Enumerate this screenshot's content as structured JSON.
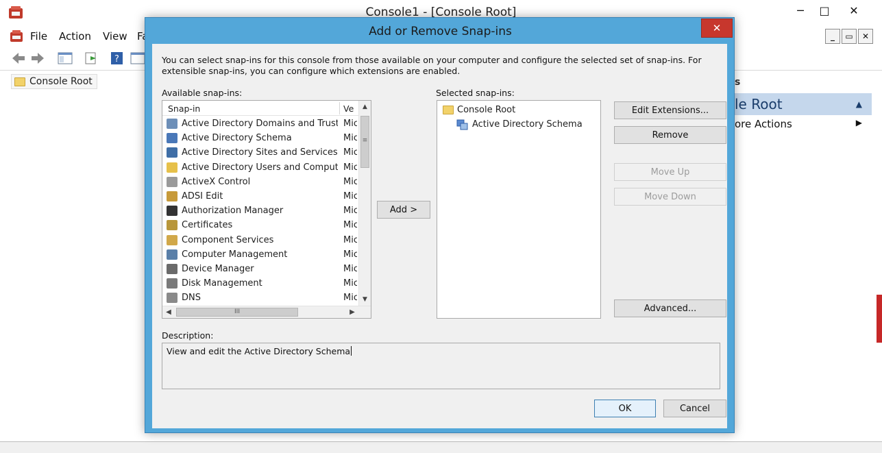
{
  "window": {
    "title": "Console1 - [Console Root]",
    "minimize": "─",
    "maximize": "□",
    "close": "✕"
  },
  "menu": {
    "items": [
      "File",
      "Action",
      "View",
      "Fa"
    ]
  },
  "inner_controls": {
    "minimize": "_",
    "restore": "▭",
    "close": "✕"
  },
  "tree": {
    "root": "Console Root"
  },
  "actions_pane": {
    "header": "s",
    "section": "le Root",
    "more_actions": "ore Actions"
  },
  "status_bar": {
    "cells": [
      "",
      "",
      "",
      "",
      ""
    ]
  },
  "dialog": {
    "title": "Add or Remove Snap-ins",
    "close": "✕",
    "intro": "You can select snap-ins for this console from those available on your computer and configure the selected set of snap-ins. For extensible snap-ins, you can configure which extensions are enabled.",
    "available_label": "Available snap-ins:",
    "selected_label": "Selected snap-ins:",
    "columns": {
      "snapin": "Snap-in",
      "vendor": "Ve"
    },
    "snapins": [
      {
        "name": "Active Directory Domains and Trusts",
        "vendor": "Mic",
        "icon": "domains-trusts-icon",
        "color": "#6d8fb8"
      },
      {
        "name": "Active Directory Schema",
        "vendor": "Mic",
        "icon": "schema-icon",
        "color": "#4a78b8"
      },
      {
        "name": "Active Directory Sites and Services",
        "vendor": "Mic",
        "icon": "sites-services-icon",
        "color": "#3f6ea6"
      },
      {
        "name": "Active Directory Users and Comput...",
        "vendor": "Mic",
        "icon": "users-computers-icon",
        "color": "#e6c04a"
      },
      {
        "name": "ActiveX Control",
        "vendor": "Mic",
        "icon": "activex-icon",
        "color": "#9a9a9a"
      },
      {
        "name": "ADSI Edit",
        "vendor": "Mic",
        "icon": "adsi-edit-icon",
        "color": "#c79a3a"
      },
      {
        "name": "Authorization Manager",
        "vendor": "Mic",
        "icon": "authorization-icon",
        "color": "#333333"
      },
      {
        "name": "Certificates",
        "vendor": "Mic",
        "icon": "certificates-icon",
        "color": "#b8963a"
      },
      {
        "name": "Component Services",
        "vendor": "Mic",
        "icon": "component-services-icon",
        "color": "#d1a84a"
      },
      {
        "name": "Computer Management",
        "vendor": "Mic",
        "icon": "computer-management-icon",
        "color": "#5a7fa8"
      },
      {
        "name": "Device Manager",
        "vendor": "Mic",
        "icon": "device-manager-icon",
        "color": "#6a6a6a"
      },
      {
        "name": "Disk Management",
        "vendor": "Mic",
        "icon": "disk-management-icon",
        "color": "#7a7a7a"
      },
      {
        "name": "DNS",
        "vendor": "Mic",
        "icon": "dns-icon",
        "color": "#8a8a8a"
      }
    ],
    "add_button": "Add >",
    "selected_tree": {
      "root": "Console Root",
      "child": "Active Directory Schema"
    },
    "buttons": {
      "edit_extensions": "Edit Extensions...",
      "remove": "Remove",
      "move_up": "Move Up",
      "move_down": "Move Down",
      "advanced": "Advanced..."
    },
    "description_label": "Description:",
    "description": "View and edit the Active Directory Schema",
    "ok": "OK",
    "cancel": "Cancel"
  },
  "scroll_glyphs": {
    "up": "▲",
    "down": "▼",
    "left": "◀",
    "right": "▶",
    "grip_v": "≡",
    "grip_h": "III"
  },
  "colors": {
    "dialog_frame": "#53a7d9",
    "close_button": "#c7372d",
    "actions_band": "#c5d7ec"
  }
}
